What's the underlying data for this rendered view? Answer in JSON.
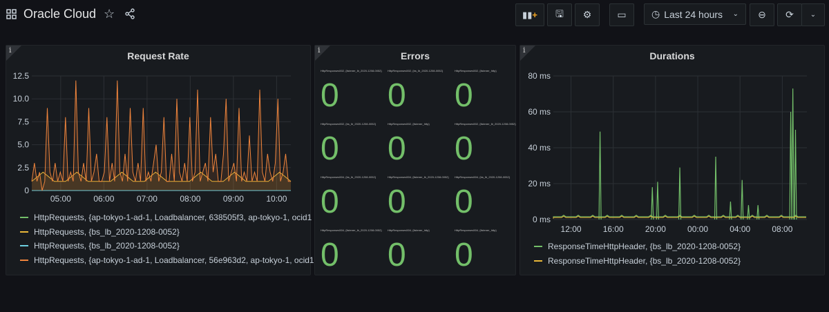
{
  "header": {
    "title": "Oracle Cloud",
    "time_range": "Last 24 hours",
    "icons": [
      "grid-icon",
      "star-icon",
      "share-icon",
      "add-panel-icon",
      "save-icon",
      "gear-icon",
      "tv-icon",
      "clock-icon",
      "chevron-down-icon",
      "zoom-out-icon",
      "refresh-icon",
      "chevron-down-icon"
    ]
  },
  "panels": {
    "request_rate": {
      "title": "Request Rate",
      "legend": [
        "HttpRequests, {ap-tokyo-1-ad-1, Loadbalancer, 638505f3, ap-tokyo-1, ocid1",
        "HttpRequests, {bs_lb_2020-1208-0052}",
        "HttpRequests, {bs_lb_2020-1208-0052}",
        "HttpRequests, {ap-tokyo-1-ad-1, Loadbalancer, 56e963d2, ap-tokyo-1, ocid1"
      ]
    },
    "errors": {
      "title": "Errors",
      "stats": [
        {
          "label": "HttpResponses502, {listener_lb_2020-1208-0052}",
          "value": "0"
        },
        {
          "label": "HttpResponses502, {bs_lb_2020-1208-0052}",
          "value": "0"
        },
        {
          "label": "HttpResponses502, {listener_http}",
          "value": "0"
        },
        {
          "label": "HttpResponses502, {bs_lb_2020-1208-0052}",
          "value": "0"
        },
        {
          "label": "HttpResponses502, {listener_http}",
          "value": "0"
        },
        {
          "label": "HttpResponses502, {listener_lb_2020-1208-0052}",
          "value": "0"
        },
        {
          "label": "HttpResponses504, {bs_lb_2020-1208-0052}",
          "value": "0"
        },
        {
          "label": "HttpResponses504, {listener_lb_2020-1208-0052}",
          "value": "0"
        },
        {
          "label": "HttpResponses504, {bs_lb_2020-1208-0052}",
          "value": "0"
        },
        {
          "label": "HttpResponses504, {listener_lb_2020-1208-0052}",
          "value": "0"
        },
        {
          "label": "HttpResponses504, {listener_http}",
          "value": "0"
        },
        {
          "label": "HttpResponses504, {listener_http}",
          "value": "0"
        }
      ]
    },
    "durations": {
      "title": "Durations",
      "legend": [
        "ResponseTimeHttpHeader, {bs_lb_2020-1208-0052}",
        "ResponseTimeHttpHeader, {bs_lb_2020-1208-0052}"
      ]
    }
  },
  "chart_data": [
    {
      "type": "line",
      "ylim": [
        0,
        12.5
      ],
      "yticks": [
        "0",
        "2.5",
        "5.0",
        "7.5",
        "10.0",
        "12.5"
      ],
      "xticks": [
        "05:00",
        "06:00",
        "07:00",
        "08:00",
        "09:00",
        "10:00"
      ],
      "xrange_hours": [
        4.33,
        10.33
      ],
      "series": [
        {
          "name": "HttpRequests, {ap-tokyo-1-ad-1, Loadbalancer, 638505f3, ap-tokyo-1, ocid1",
          "color": "#73bf69",
          "values": [
            0,
            0,
            0,
            0,
            0,
            0
          ]
        },
        {
          "name": "HttpRequests, {bs_lb_2020-1208-0052}",
          "color": "#eab839",
          "values": [
            1,
            2,
            1,
            1,
            2,
            1,
            1,
            1,
            2,
            1,
            1,
            2,
            1,
            1,
            1,
            2,
            1,
            1,
            2,
            1,
            1,
            1,
            2,
            1
          ]
        },
        {
          "name": "HttpRequests, {bs_lb_2020-1208-0052}",
          "color": "#6ed0e0",
          "values": [
            0,
            0,
            0,
            0,
            0,
            0
          ]
        },
        {
          "name": "HttpRequests, {ap-tokyo-1-ad-1, Loadbalancer, 56e963d2, ap-tokyo-1, ocid1",
          "color": "#ef843c",
          "values": [
            1,
            3,
            1,
            2,
            0,
            1,
            9,
            2,
            1,
            3,
            1,
            2,
            1,
            8,
            1,
            2,
            1,
            12,
            2,
            1,
            3,
            1,
            9,
            1,
            2,
            4,
            1,
            1,
            2,
            8,
            1,
            3,
            1,
            12,
            2,
            1,
            4,
            1,
            9,
            2,
            1,
            3,
            1,
            9,
            1,
            2,
            1,
            3,
            5,
            1,
            2,
            8,
            1,
            1,
            4,
            1,
            10,
            2,
            1,
            3,
            1,
            8,
            1,
            2,
            11,
            1,
            2,
            3,
            1,
            8,
            2,
            4,
            1,
            1,
            4,
            10,
            1,
            2,
            3,
            1,
            9,
            1,
            2,
            1,
            6,
            1,
            2,
            1,
            11,
            2,
            1,
            4,
            2,
            1,
            3,
            10,
            1,
            2,
            4,
            1,
            1
          ]
        }
      ]
    },
    {
      "type": "line",
      "ylim": [
        0,
        80
      ],
      "yticks": [
        "0 ms",
        "20 ms",
        "40 ms",
        "60 ms",
        "80 ms"
      ],
      "xticks": [
        "12:00",
        "16:00",
        "20:00",
        "00:00",
        "04:00",
        "08:00"
      ],
      "series": [
        {
          "name": "ResponseTimeHttpHeader, {bs_lb_2020-1208-0052}",
          "color": "#73bf69",
          "spikes": [
            [
              14.75,
              49
            ],
            [
              19.7,
              18
            ],
            [
              20.2,
              21
            ],
            [
              22.3,
              29
            ],
            [
              25.7,
              35
            ],
            [
              27.1,
              10
            ],
            [
              28.2,
              22
            ],
            [
              28.8,
              8
            ],
            [
              29.7,
              8
            ],
            [
              32.8,
              60
            ],
            [
              33.0,
              73
            ],
            [
              33.25,
              50
            ]
          ],
          "baseline": 1
        },
        {
          "name": "ResponseTimeHttpHeader, {bs_lb_2020-1208-0052}",
          "color": "#eab839",
          "spikes": [],
          "baseline": 0.5
        }
      ]
    }
  ]
}
